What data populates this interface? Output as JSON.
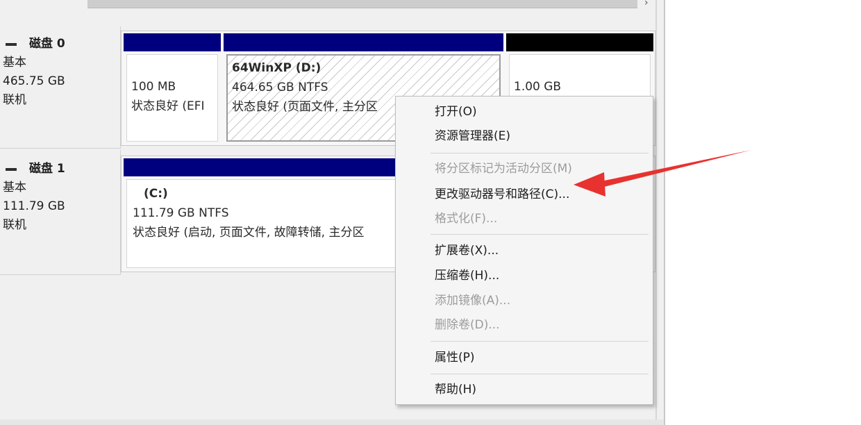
{
  "disks": [
    {
      "name": "磁盘 0",
      "type": "基本",
      "size": "465.75 GB",
      "status": "联机",
      "partitions": [
        {
          "lines": [
            "100 MB",
            "状态良好 (EFI"
          ]
        },
        {
          "title": "64WinXP   (D:)",
          "lines": [
            "464.65 GB NTFS",
            "状态良好 (页面文件, 主分区"
          ]
        },
        {
          "lines": [
            "1.00 GB"
          ]
        }
      ]
    },
    {
      "name": "磁盘 1",
      "type": "基本",
      "size": "111.79 GB",
      "status": "联机",
      "partitions": [
        {
          "title": "(C:)",
          "lines": [
            "111.79 GB NTFS",
            "状态良好 (启动, 页面文件, 故障转储, 主分区"
          ]
        }
      ]
    }
  ],
  "context_menu": {
    "items": [
      {
        "label": "打开(O)",
        "enabled": true
      },
      {
        "label": "资源管理器(E)",
        "enabled": true
      },
      {
        "label": "将分区标记为活动分区(M)",
        "enabled": false
      },
      {
        "label": "更改驱动器号和路径(C)...",
        "enabled": true
      },
      {
        "label": "格式化(F)...",
        "enabled": false
      },
      {
        "label": "扩展卷(X)...",
        "enabled": true
      },
      {
        "label": "压缩卷(H)...",
        "enabled": true
      },
      {
        "label": "添加镜像(A)...",
        "enabled": false
      },
      {
        "label": "删除卷(D)...",
        "enabled": false
      },
      {
        "label": "属性(P)",
        "enabled": true
      },
      {
        "label": "帮助(H)",
        "enabled": true
      }
    ]
  },
  "colors": {
    "primary_partition_bar": "#00007f",
    "unallocated_bar": "#000000",
    "annotation_arrow": "#e8322f"
  }
}
